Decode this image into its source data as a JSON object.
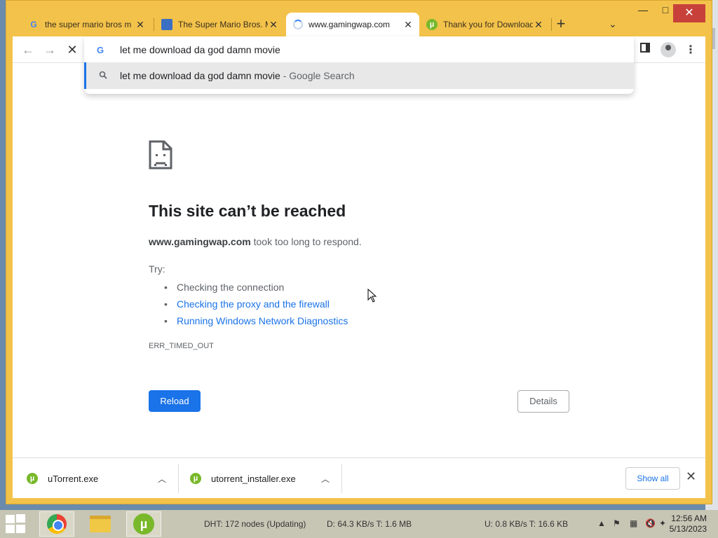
{
  "window": {
    "tabs": [
      {
        "title": "the super mario bros m",
        "favicon": "google-icon"
      },
      {
        "title": "The Super Mario Bros. M",
        "favicon": "mario-icon"
      },
      {
        "title": "www.gamingwap.com",
        "favicon": "loading-spinner-icon",
        "active": true
      },
      {
        "title": "Thank you for Download",
        "favicon": "utorrent-icon"
      }
    ],
    "new_tab_label": "+",
    "tab_list_label": "⌄",
    "minimize_label": "—",
    "maximize_label": "□",
    "close_label": "✕"
  },
  "toolbar": {
    "back_label": "←",
    "forward_label": "→",
    "stop_label": "✕"
  },
  "omnibox": {
    "query": "let me download da god damn movie",
    "suggestion_text": "let me download da god damn movie",
    "suggestion_suffix": " - Google Search"
  },
  "error_page": {
    "title": "This site can’t be reached",
    "host": "www.gamingwap.com",
    "desc_rest": " took too long to respond.",
    "try_label": "Try:",
    "tips": [
      {
        "text": "Checking the connection",
        "link": false
      },
      {
        "text": "Checking the proxy and the firewall",
        "link": true
      },
      {
        "text": "Running Windows Network Diagnostics",
        "link": true
      }
    ],
    "error_code": "ERR_TIMED_OUT",
    "reload_label": "Reload",
    "details_label": "Details"
  },
  "downloads": {
    "items": [
      {
        "name": "uTorrent.exe"
      },
      {
        "name": "utorrent_installer.exe"
      }
    ],
    "show_all_label": "Show all",
    "close_label": "✕"
  },
  "taskbar": {
    "dht": "DHT: 172 nodes (Updating)",
    "download": "D: 64.3 KB/s T: 1.6 MB",
    "upload": "U: 0.8 KB/s T: 16.6 KB",
    "time": "12:56 AM",
    "date": "5/13/2023"
  },
  "colors": {
    "titlebar": "#f3c24a",
    "accent_blue": "#1a73e8",
    "close_red": "#c7413a",
    "taskbar": "#c7c6b5"
  }
}
